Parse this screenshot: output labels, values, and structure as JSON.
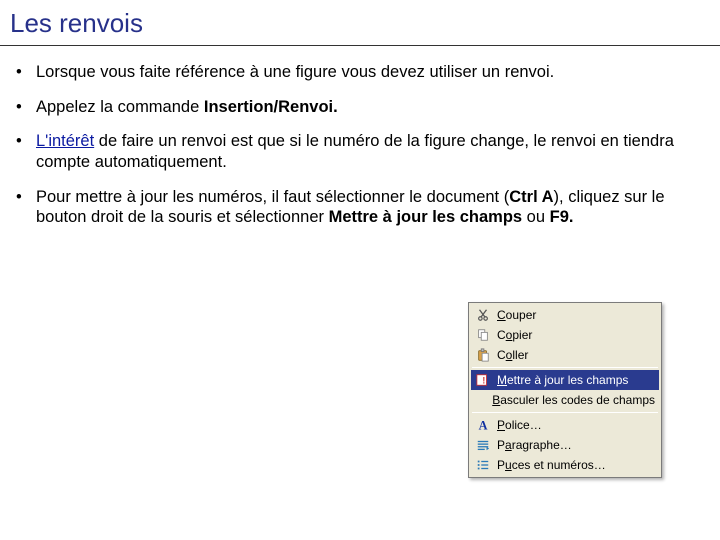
{
  "title": "Les renvois",
  "bullets": [
    {
      "text": "Lorsque vous faite référence à une figure vous devez utiliser un renvoi."
    },
    {
      "html": "Appelez la commande <span class=\"bold\">Insertion/Renvoi.</span>"
    },
    {
      "html": "<span class=\"link-like\">L'intérêt</span> de faire un renvoi est que si le numéro de la figure change, le renvoi en tiendra compte automatiquement."
    },
    {
      "html": "Pour mettre à jour les numéros, il faut sélectionner le document (<span class=\"bold\">Ctrl A</span>), cliquez sur le bouton droit de la souris et sélectionner <span class=\"bold\">Mettre à jour les champs</span> ou <span class=\"bold\">F9.</span>"
    }
  ],
  "menu": {
    "items": [
      {
        "id": "cut",
        "icon": "scissors-icon",
        "pre": "",
        "accel": "C",
        "post": "ouper"
      },
      {
        "id": "copy",
        "icon": "copy-icon",
        "pre": "C",
        "accel": "o",
        "post": "pier"
      },
      {
        "id": "paste",
        "icon": "paste-icon",
        "pre": "C",
        "accel": "o",
        "post": "ller"
      },
      {
        "sep": true
      },
      {
        "id": "update",
        "icon": "update-icon",
        "pre": "",
        "accel": "M",
        "post": "ettre à jour les champs",
        "highlight": true
      },
      {
        "id": "toggle",
        "icon": "",
        "pre": "",
        "accel": "B",
        "post": "asculer les codes de champs"
      },
      {
        "sep": true
      },
      {
        "id": "font",
        "icon": "font-icon",
        "pre": "",
        "accel": "P",
        "post": "olice…"
      },
      {
        "id": "para",
        "icon": "para-icon",
        "pre": "P",
        "accel": "a",
        "post": "ragraphe…"
      },
      {
        "id": "bnums",
        "icon": "list-icon",
        "pre": "P",
        "accel": "u",
        "post": "ces et numéros…"
      }
    ]
  }
}
